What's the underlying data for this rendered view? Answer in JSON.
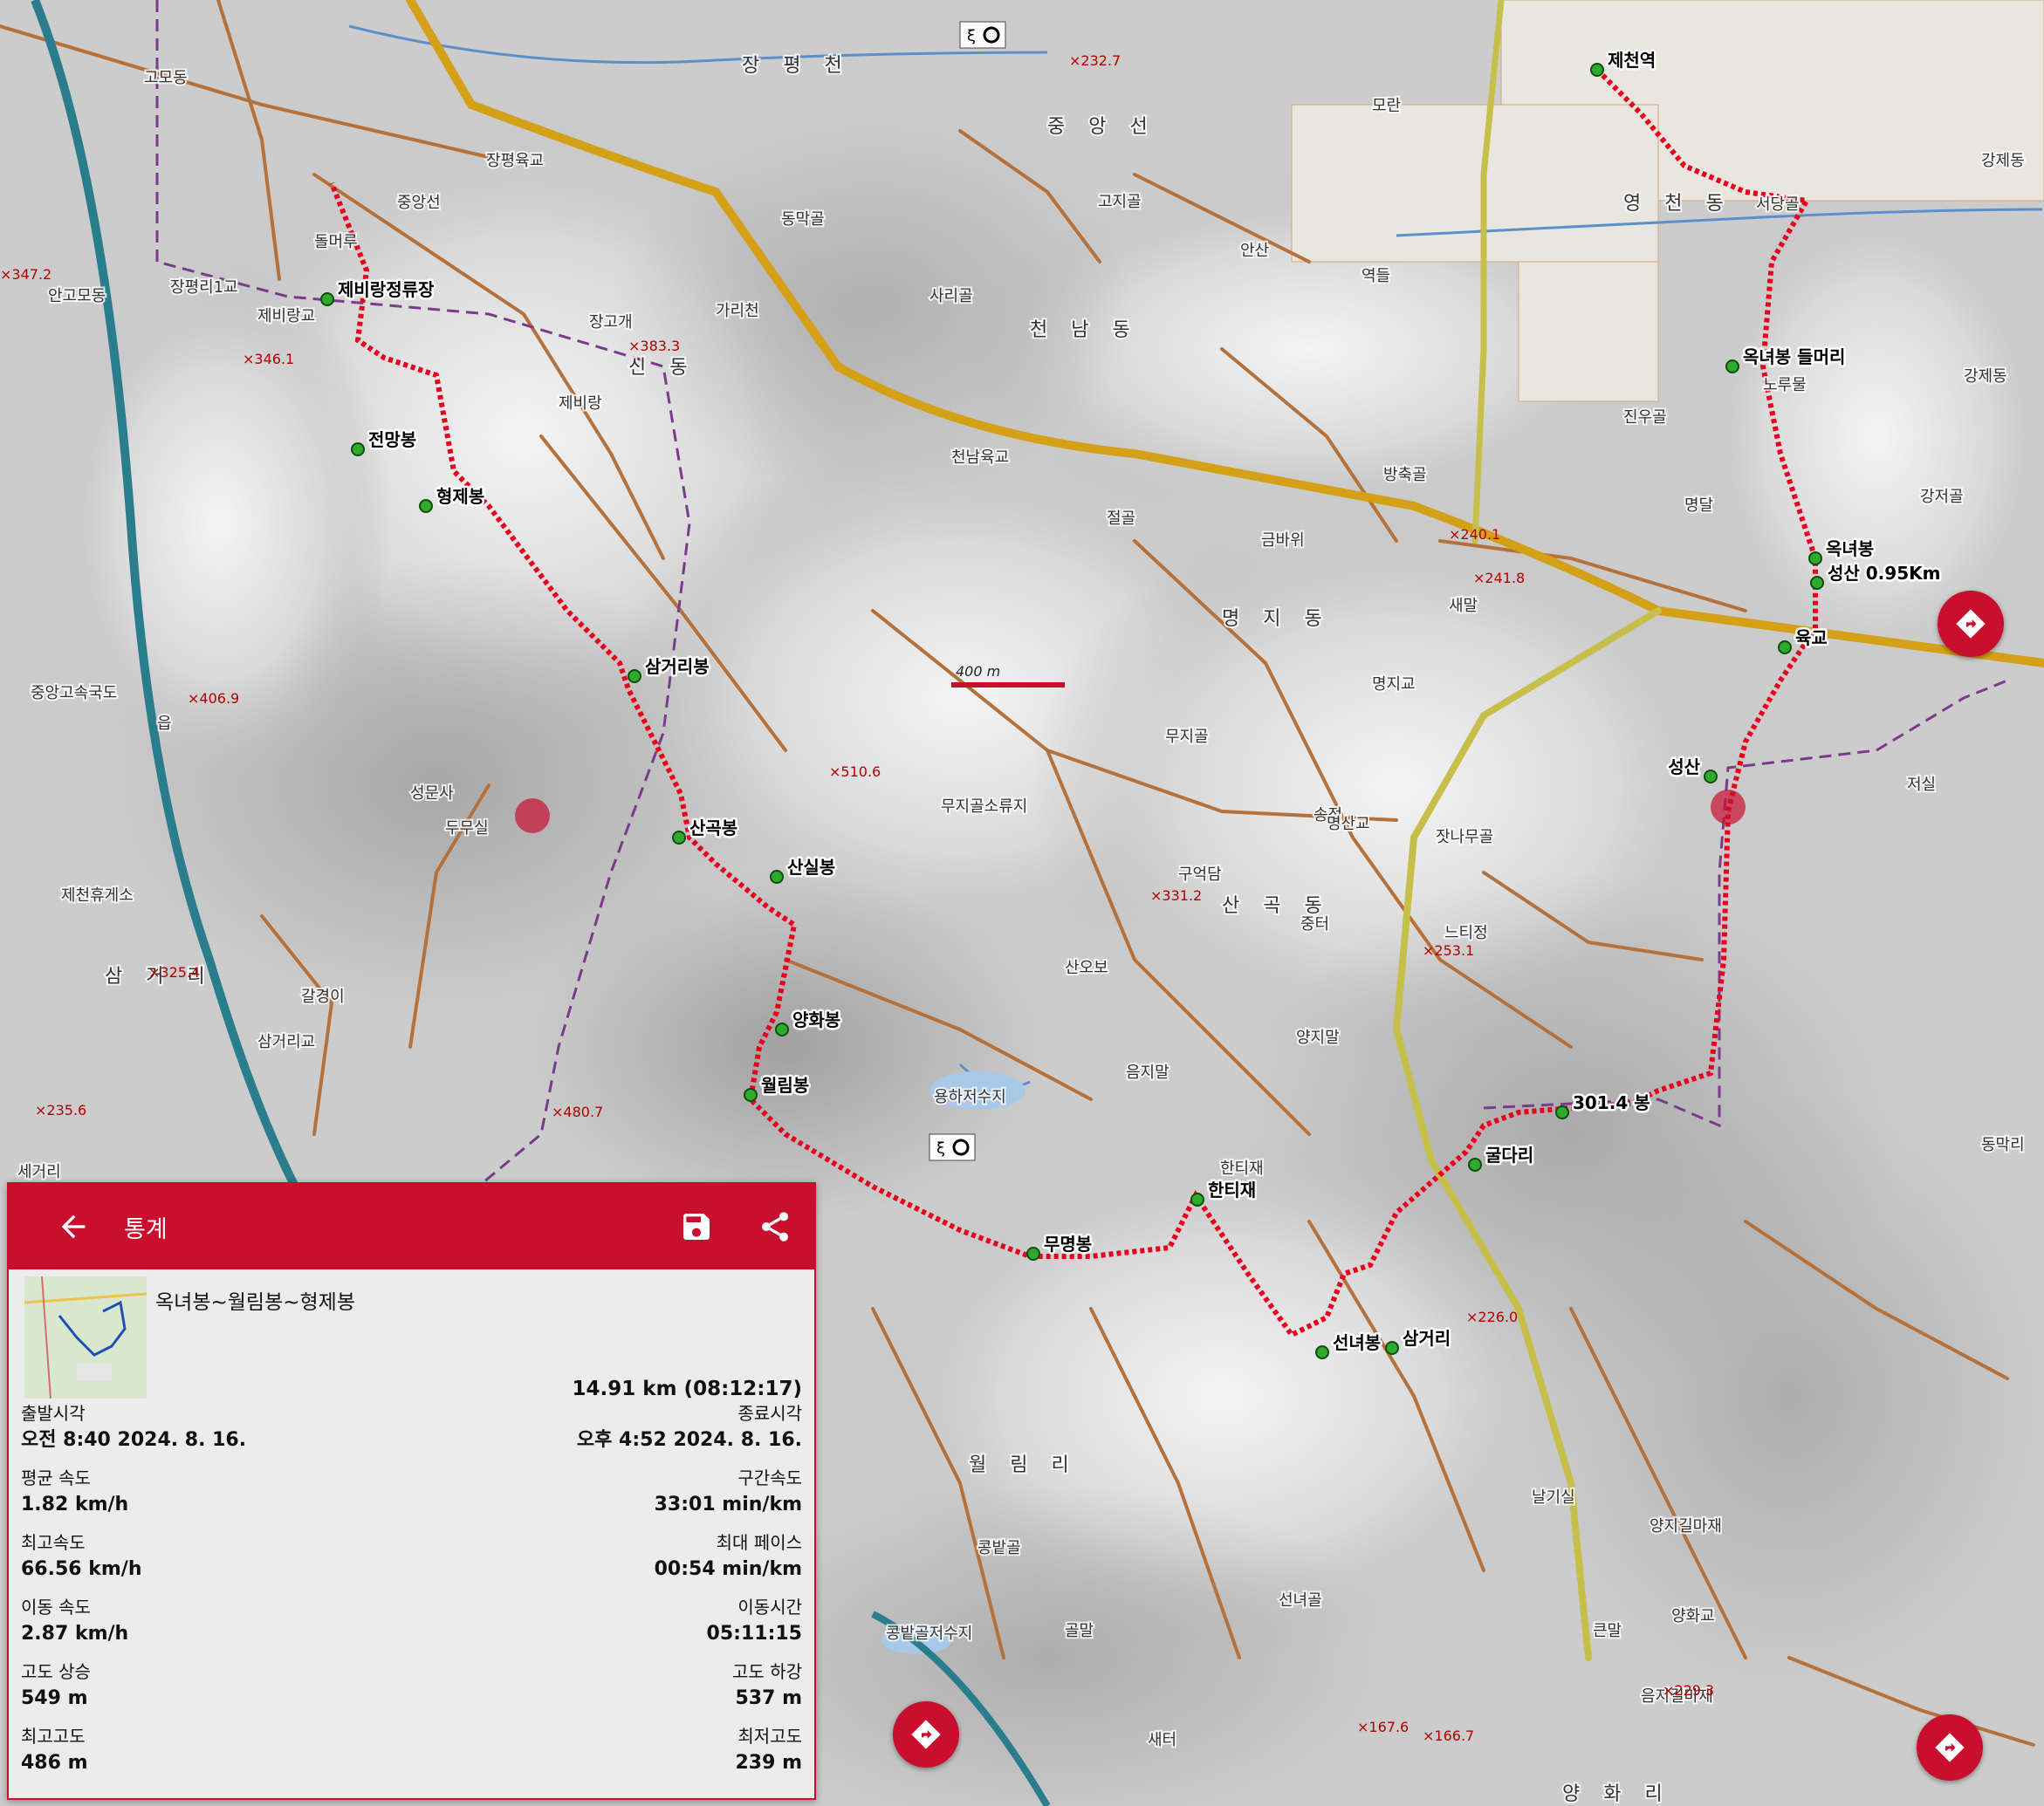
{
  "map": {
    "scale_label": "400 m",
    "route_color": "#e8001c",
    "waypoints": [
      {
        "name": "제천역"
      },
      {
        "name": "옥녀봉 들머리"
      },
      {
        "name": "옥녀봉"
      },
      {
        "name": "성산 0.95Km"
      },
      {
        "name": "육교"
      },
      {
        "name": "성산"
      },
      {
        "name": "301.4 봉"
      },
      {
        "name": "굴다리"
      },
      {
        "name": "삼거리"
      },
      {
        "name": "선녀봉"
      },
      {
        "name": "한티재"
      },
      {
        "name": "무명봉"
      },
      {
        "name": "월림봉"
      },
      {
        "name": "양화봉"
      },
      {
        "name": "산실봉"
      },
      {
        "name": "산곡봉"
      },
      {
        "name": "삼거리봉"
      },
      {
        "name": "형제봉"
      },
      {
        "name": "전망봉"
      },
      {
        "name": "제비랑정류장"
      }
    ],
    "places": [
      {
        "name": "중앙선"
      },
      {
        "name": "돌머루"
      },
      {
        "name": "안고모동"
      },
      {
        "name": "고모동"
      },
      {
        "name": "장평리1교"
      },
      {
        "name": "제비랑교"
      },
      {
        "name": "장고개"
      },
      {
        "name": "신 동"
      },
      {
        "name": "제비랑"
      },
      {
        "name": "가리천"
      },
      {
        "name": "동막골"
      },
      {
        "name": "사리골"
      },
      {
        "name": "천 남 동"
      },
      {
        "name": "고지골"
      },
      {
        "name": "천남육교"
      },
      {
        "name": "절골"
      },
      {
        "name": "금바위"
      },
      {
        "name": "명 지 동"
      },
      {
        "name": "새말"
      },
      {
        "name": "명지교"
      },
      {
        "name": "무지골"
      },
      {
        "name": "무지골소류지"
      },
      {
        "name": "구억담"
      },
      {
        "name": "산 곡 동"
      },
      {
        "name": "송정"
      },
      {
        "name": "잣나무골"
      },
      {
        "name": "명산교"
      },
      {
        "name": "느티정"
      },
      {
        "name": "중터"
      },
      {
        "name": "양지말"
      },
      {
        "name": "산오보"
      },
      {
        "name": "음지말"
      },
      {
        "name": "용하저수지"
      },
      {
        "name": "한티재"
      },
      {
        "name": "두무실"
      },
      {
        "name": "성문사"
      },
      {
        "name": "갈경이"
      },
      {
        "name": "삼거리교"
      },
      {
        "name": "삼 거 리"
      },
      {
        "name": "제천휴게소"
      },
      {
        "name": "읍"
      },
      {
        "name": "월 림 리"
      },
      {
        "name": "콩밭골"
      },
      {
        "name": "골말"
      },
      {
        "name": "선녀골"
      },
      {
        "name": "날기실"
      },
      {
        "name": "큰말"
      },
      {
        "name": "양지길마재"
      },
      {
        "name": "음지길마재"
      },
      {
        "name": "저실"
      },
      {
        "name": "동막리"
      },
      {
        "name": "강제동"
      },
      {
        "name": "노루물"
      },
      {
        "name": "강저골"
      },
      {
        "name": "명달"
      },
      {
        "name": "진우골"
      },
      {
        "name": "방축골"
      },
      {
        "name": "역들"
      },
      {
        "name": "안산"
      },
      {
        "name": "모란"
      },
      {
        "name": "영 천 동"
      },
      {
        "name": "서당골"
      },
      {
        "name": "중 앙 선"
      },
      {
        "name": "장평육교"
      },
      {
        "name": "장 평 천"
      },
      {
        "name": "콩밭골저수지"
      },
      {
        "name": "새터"
      },
      {
        "name": "세거리"
      },
      {
        "name": "강제동"
      },
      {
        "name": "양화교"
      },
      {
        "name": "양 화 리"
      },
      {
        "name": "중앙고속국도"
      }
    ],
    "elevations": [
      {
        "value": "347.2"
      },
      {
        "value": "346.1"
      },
      {
        "value": "383.3"
      },
      {
        "value": "406.9"
      },
      {
        "value": "510.6"
      },
      {
        "value": "325.4"
      },
      {
        "value": "480.7"
      },
      {
        "value": "235.6"
      },
      {
        "value": "232.7"
      },
      {
        "value": "331.2"
      },
      {
        "value": "253.1"
      },
      {
        "value": "226.0"
      },
      {
        "value": "240.1"
      },
      {
        "value": "241.8"
      },
      {
        "value": "229.3"
      },
      {
        "value": "167.6"
      },
      {
        "value": "166.7"
      }
    ]
  },
  "panel": {
    "title": "통계",
    "route_name": "옥녀봉~월림봉~형제봉",
    "total": "14.91 km (08:12:17)",
    "stats": [
      {
        "left_label": "출발시각",
        "left_value": "오전 8:40 2024. 8. 16.",
        "right_label": "종료시각",
        "right_value": "오후 4:52 2024. 8. 16."
      },
      {
        "left_label": "평균 속도",
        "left_value": "1.82 km/h",
        "right_label": "구간속도",
        "right_value": "33:01 min/km"
      },
      {
        "left_label": "최고속도",
        "left_value": "66.56 km/h",
        "right_label": "최대 페이스",
        "right_value": "00:54 min/km"
      },
      {
        "left_label": "이동 속도",
        "left_value": "2.87 km/h",
        "right_label": "이동시간",
        "right_value": "05:11:15"
      },
      {
        "left_label": "고도 상승",
        "left_value": "549 m",
        "right_label": "고도 하강",
        "right_value": "537 m"
      },
      {
        "left_label": "최고고도",
        "left_value": "486 m",
        "right_label": "최저고도",
        "right_value": "239 m"
      }
    ]
  },
  "icons": {
    "back": "arrow-left-icon",
    "save": "floppy-disk-icon",
    "share": "share-icon",
    "navigate": "directions-icon"
  }
}
